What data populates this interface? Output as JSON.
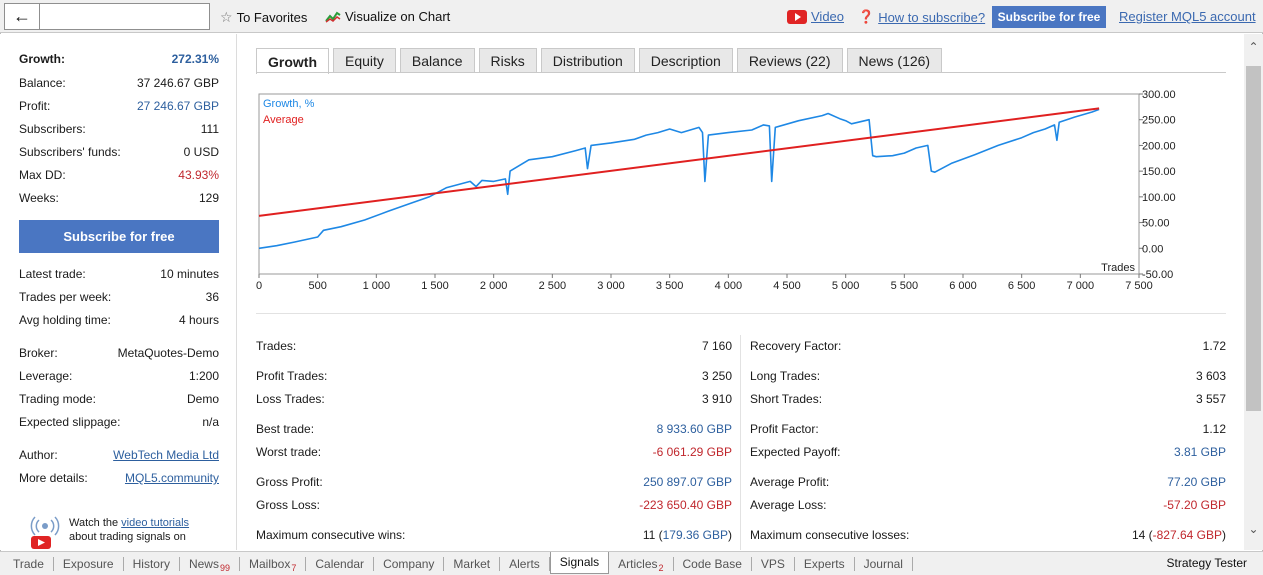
{
  "toolbar": {
    "back_icon": "arrow-left-icon",
    "favorites": "To Favorites",
    "visualize": "Visualize on Chart",
    "video": "Video",
    "how_to_subscribe": "How to subscribe?",
    "subscribe_button": "Subscribe for free",
    "register": "Register MQL5 account"
  },
  "summary": {
    "growth_label": "Growth:",
    "growth_value": "272.31%",
    "balance_label": "Balance:",
    "balance_value": "37 246.67 GBP",
    "profit_label": "Profit:",
    "profit_value": "27 246.67 GBP",
    "subscribers_label": "Subscribers:",
    "subscribers_value": "111",
    "funds_label": "Subscribers' funds:",
    "funds_value": "0 USD",
    "maxdd_label": "Max DD:",
    "maxdd_value": "43.93%",
    "weeks_label": "Weeks:",
    "weeks_value": "129",
    "subscribe_button": "Subscribe for free",
    "latest_trade_label": "Latest trade:",
    "latest_trade_value": "10 minutes",
    "tpw_label": "Trades per week:",
    "tpw_value": "36",
    "holding_label": "Avg holding time:",
    "holding_value": "4 hours",
    "broker_label": "Broker:",
    "broker_value": "MetaQuotes-Demo",
    "leverage_label": "Leverage:",
    "leverage_value": "1:200",
    "mode_label": "Trading mode:",
    "mode_value": "Demo",
    "slippage_label": "Expected slippage:",
    "slippage_value": "n/a",
    "author_label": "Author:",
    "author_value": "WebTech Media Ltd",
    "details_label": "More details:",
    "details_value": "MQL5.community",
    "tutorial_pre": "Watch the ",
    "tutorial_link": "video tutorials",
    "tutorial_post": "about trading signals on"
  },
  "tabs": [
    "Growth",
    "Equity",
    "Balance",
    "Risks",
    "Distribution",
    "Description",
    "Reviews (22)",
    "News (126)"
  ],
  "chart_data": {
    "type": "line",
    "xlabel": "Trades",
    "ylabel": "",
    "xlim": [
      0,
      7500
    ],
    "ylim": [
      -50,
      300
    ],
    "x_ticks": [
      "0",
      "500",
      "1 000",
      "1 500",
      "2 000",
      "2 500",
      "3 000",
      "3 500",
      "4 000",
      "4 500",
      "5 000",
      "5 500",
      "6 000",
      "6 500",
      "7 000",
      "7 500"
    ],
    "y_ticks": [
      "300.00",
      "250.00",
      "200.00",
      "150.00",
      "100.00",
      "50.00",
      "0.00",
      "-50.00"
    ],
    "legend_position": "top-left",
    "series": [
      {
        "name": "Growth, %",
        "color": "#1e88e5",
        "points": [
          [
            0,
            0
          ],
          [
            150,
            5
          ],
          [
            300,
            12
          ],
          [
            500,
            22
          ],
          [
            550,
            35
          ],
          [
            700,
            42
          ],
          [
            900,
            55
          ],
          [
            1100,
            72
          ],
          [
            1300,
            88
          ],
          [
            1450,
            100
          ],
          [
            1600,
            118
          ],
          [
            1800,
            130
          ],
          [
            1850,
            120
          ],
          [
            1900,
            132
          ],
          [
            2000,
            130
          ],
          [
            2100,
            135
          ],
          [
            2120,
            105
          ],
          [
            2140,
            150
          ],
          [
            2300,
            172
          ],
          [
            2500,
            178
          ],
          [
            2700,
            190
          ],
          [
            2780,
            195
          ],
          [
            2800,
            155
          ],
          [
            2830,
            200
          ],
          [
            3000,
            205
          ],
          [
            3200,
            212
          ],
          [
            3300,
            220
          ],
          [
            3400,
            225
          ],
          [
            3500,
            232
          ],
          [
            3600,
            225
          ],
          [
            3750,
            235
          ],
          [
            3780,
            225
          ],
          [
            3800,
            130
          ],
          [
            3830,
            220
          ],
          [
            4000,
            225
          ],
          [
            4200,
            230
          ],
          [
            4300,
            240
          ],
          [
            4350,
            238
          ],
          [
            4370,
            130
          ],
          [
            4400,
            235
          ],
          [
            4600,
            248
          ],
          [
            4800,
            258
          ],
          [
            4850,
            262
          ],
          [
            4950,
            252
          ],
          [
            5000,
            248
          ],
          [
            5050,
            242
          ],
          [
            5200,
            250
          ],
          [
            5230,
            180
          ],
          [
            5260,
            178
          ],
          [
            5400,
            180
          ],
          [
            5500,
            185
          ],
          [
            5600,
            195
          ],
          [
            5700,
            200
          ],
          [
            5730,
            150
          ],
          [
            5760,
            148
          ],
          [
            5900,
            165
          ],
          [
            6100,
            182
          ],
          [
            6300,
            200
          ],
          [
            6500,
            215
          ],
          [
            6600,
            225
          ],
          [
            6700,
            232
          ],
          [
            6780,
            240
          ],
          [
            6800,
            210
          ],
          [
            6820,
            245
          ],
          [
            6950,
            255
          ],
          [
            7100,
            265
          ],
          [
            7160,
            270
          ]
        ]
      },
      {
        "name": "Average",
        "color": "#e02020",
        "points": [
          [
            0,
            63
          ],
          [
            7160,
            272
          ]
        ]
      }
    ]
  },
  "stats_left": [
    {
      "label": "Trades:",
      "value": "7 160"
    },
    {
      "label": "Profit Trades:",
      "value": "3 250"
    },
    {
      "label": "Loss Trades:",
      "value": "3 910"
    },
    {
      "label": "Best trade:",
      "value": "8 933.60 GBP"
    },
    {
      "label": "Worst trade:",
      "value": "-6 061.29 GBP"
    },
    {
      "label": "Gross Profit:",
      "value": "250 897.07 GBP"
    },
    {
      "label": "Gross Loss:",
      "value": "-223 650.40 GBP"
    },
    {
      "label": "Maximum consecutive wins:",
      "value": "11 (179.36 GBP)"
    }
  ],
  "stats_right": [
    {
      "label": "Recovery Factor:",
      "value": "1.72"
    },
    {
      "label": "Long Trades:",
      "value": "3 603"
    },
    {
      "label": "Short Trades:",
      "value": "3 557"
    },
    {
      "label": "Profit Factor:",
      "value": "1.12"
    },
    {
      "label": "Expected Payoff:",
      "value": "3.81 GBP"
    },
    {
      "label": "Average Profit:",
      "value": "77.20 GBP"
    },
    {
      "label": "Average Loss:",
      "value": "-57.20 GBP"
    },
    {
      "label": "Maximum consecutive losses:",
      "value": "14 (-827.64 GBP)"
    }
  ],
  "bottom_tabs": [
    {
      "label": "Trade",
      "badge": ""
    },
    {
      "label": "Exposure",
      "badge": ""
    },
    {
      "label": "History",
      "badge": ""
    },
    {
      "label": "News",
      "badge": "99"
    },
    {
      "label": "Mailbox",
      "badge": "7"
    },
    {
      "label": "Calendar",
      "badge": ""
    },
    {
      "label": "Company",
      "badge": ""
    },
    {
      "label": "Market",
      "badge": ""
    },
    {
      "label": "Alerts",
      "badge": ""
    },
    {
      "label": "Signals",
      "badge": ""
    },
    {
      "label": "Articles",
      "badge": "2"
    },
    {
      "label": "Code Base",
      "badge": ""
    },
    {
      "label": "VPS",
      "badge": ""
    },
    {
      "label": "Experts",
      "badge": ""
    },
    {
      "label": "Journal",
      "badge": ""
    }
  ],
  "bottom_active": "Signals",
  "strategy_tester": "Strategy Tester",
  "colors": {
    "accent": "#4a76c2",
    "positive": "#2d5f9e",
    "negative": "#c0272d"
  }
}
